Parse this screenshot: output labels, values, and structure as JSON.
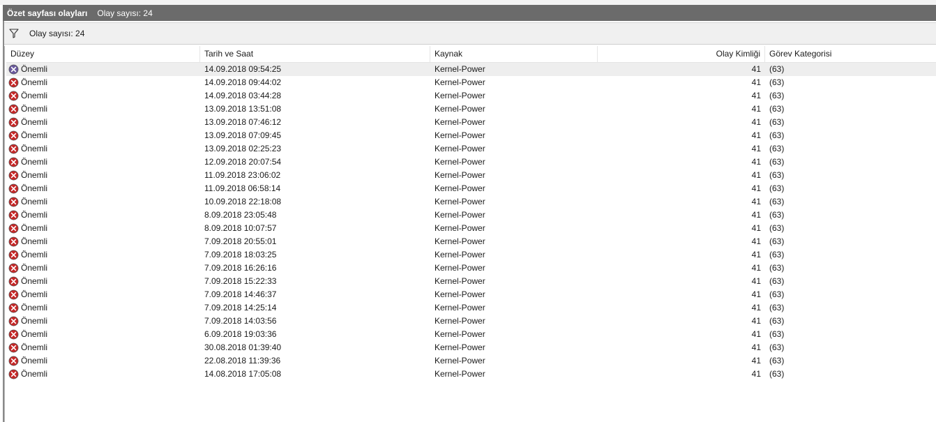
{
  "window": {
    "title": "Özet sayfası olayları",
    "count": "Olay sayısı: 24"
  },
  "filter": {
    "icon": "filter-icon",
    "count": "Olay sayısı: 24"
  },
  "colors": {
    "titlebar": "#6b6b6b",
    "error_icon": "#c62828",
    "selected_icon": "#6a5a9e"
  },
  "columns": [
    "Düzey",
    "Tarih ve Saat",
    "Kaynak",
    "Olay Kimliği",
    "Görev Kategorisi"
  ],
  "rows": [
    {
      "level": "Önemli",
      "datetime": "14.09.2018 09:54:25",
      "source": "Kernel-Power",
      "event_id": "41",
      "task": "(63)"
    },
    {
      "level": "Önemli",
      "datetime": "14.09.2018 09:44:02",
      "source": "Kernel-Power",
      "event_id": "41",
      "task": "(63)"
    },
    {
      "level": "Önemli",
      "datetime": "14.09.2018 03:44:28",
      "source": "Kernel-Power",
      "event_id": "41",
      "task": "(63)"
    },
    {
      "level": "Önemli",
      "datetime": "13.09.2018 13:51:08",
      "source": "Kernel-Power",
      "event_id": "41",
      "task": "(63)"
    },
    {
      "level": "Önemli",
      "datetime": "13.09.2018 07:46:12",
      "source": "Kernel-Power",
      "event_id": "41",
      "task": "(63)"
    },
    {
      "level": "Önemli",
      "datetime": "13.09.2018 07:09:45",
      "source": "Kernel-Power",
      "event_id": "41",
      "task": "(63)"
    },
    {
      "level": "Önemli",
      "datetime": "13.09.2018 02:25:23",
      "source": "Kernel-Power",
      "event_id": "41",
      "task": "(63)"
    },
    {
      "level": "Önemli",
      "datetime": "12.09.2018 20:07:54",
      "source": "Kernel-Power",
      "event_id": "41",
      "task": "(63)"
    },
    {
      "level": "Önemli",
      "datetime": "11.09.2018 23:06:02",
      "source": "Kernel-Power",
      "event_id": "41",
      "task": "(63)"
    },
    {
      "level": "Önemli",
      "datetime": "11.09.2018 06:58:14",
      "source": "Kernel-Power",
      "event_id": "41",
      "task": "(63)"
    },
    {
      "level": "Önemli",
      "datetime": "10.09.2018 22:18:08",
      "source": "Kernel-Power",
      "event_id": "41",
      "task": "(63)"
    },
    {
      "level": "Önemli",
      "datetime": "8.09.2018 23:05:48",
      "source": "Kernel-Power",
      "event_id": "41",
      "task": "(63)"
    },
    {
      "level": "Önemli",
      "datetime": "8.09.2018 10:07:57",
      "source": "Kernel-Power",
      "event_id": "41",
      "task": "(63)"
    },
    {
      "level": "Önemli",
      "datetime": "7.09.2018 20:55:01",
      "source": "Kernel-Power",
      "event_id": "41",
      "task": "(63)"
    },
    {
      "level": "Önemli",
      "datetime": "7.09.2018 18:03:25",
      "source": "Kernel-Power",
      "event_id": "41",
      "task": "(63)"
    },
    {
      "level": "Önemli",
      "datetime": "7.09.2018 16:26:16",
      "source": "Kernel-Power",
      "event_id": "41",
      "task": "(63)"
    },
    {
      "level": "Önemli",
      "datetime": "7.09.2018 15:22:33",
      "source": "Kernel-Power",
      "event_id": "41",
      "task": "(63)"
    },
    {
      "level": "Önemli",
      "datetime": "7.09.2018 14:46:37",
      "source": "Kernel-Power",
      "event_id": "41",
      "task": "(63)"
    },
    {
      "level": "Önemli",
      "datetime": "7.09.2018 14:25:14",
      "source": "Kernel-Power",
      "event_id": "41",
      "task": "(63)"
    },
    {
      "level": "Önemli",
      "datetime": "7.09.2018 14:03:56",
      "source": "Kernel-Power",
      "event_id": "41",
      "task": "(63)"
    },
    {
      "level": "Önemli",
      "datetime": "6.09.2018 19:03:36",
      "source": "Kernel-Power",
      "event_id": "41",
      "task": "(63)"
    },
    {
      "level": "Önemli",
      "datetime": "30.08.2018 01:39:40",
      "source": "Kernel-Power",
      "event_id": "41",
      "task": "(63)"
    },
    {
      "level": "Önemli",
      "datetime": "22.08.2018 11:39:36",
      "source": "Kernel-Power",
      "event_id": "41",
      "task": "(63)"
    },
    {
      "level": "Önemli",
      "datetime": "14.08.2018 17:05:08",
      "source": "Kernel-Power",
      "event_id": "41",
      "task": "(63)"
    }
  ],
  "selected_row": 0
}
